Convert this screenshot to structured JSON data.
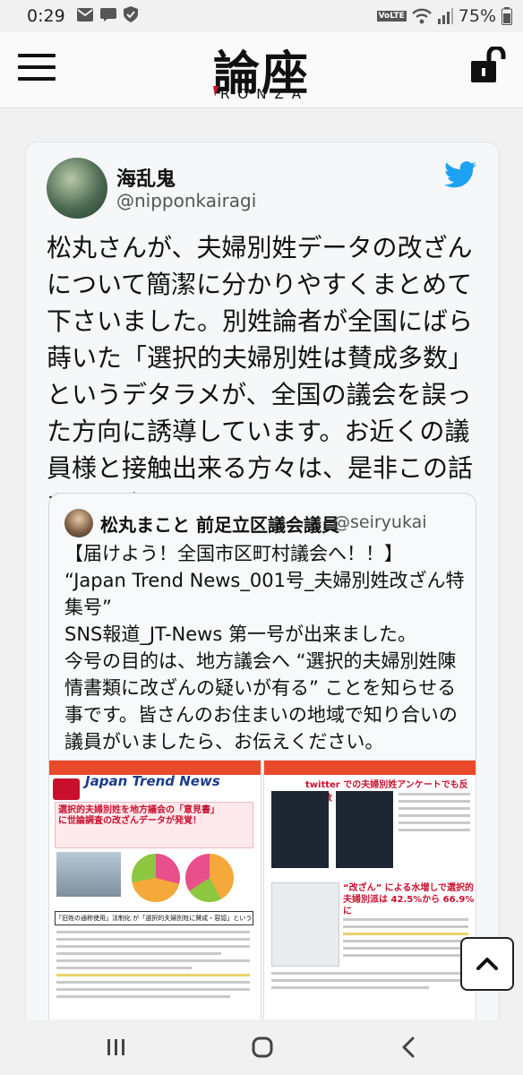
{
  "status_bar": {
    "time": "0:29",
    "battery": "75%",
    "icons": [
      "gmail-icon",
      "message-icon",
      "shield-icon",
      "volte-icon",
      "wifi-icon",
      "signal-icon",
      "battery-icon"
    ]
  },
  "header": {
    "logo_jp": "論座",
    "logo_en": "RONZA",
    "menu_icon": "hamburger-icon",
    "lock_icon": "unlock-icon"
  },
  "tweet": {
    "user_name": "海乱鬼",
    "user_handle": "@nipponkairagi",
    "text": "松丸さんが、夫婦別姓データの改ざんについて簡潔に分かりやすくまとめて下さいました。別姓論者が全国にばら蒔いた「選択的夫婦別姓は賛成多数」というデタラメが、全国の議会を誤った方向に誘導しています。お近くの議員様と接触出来る方々は、是非この話をして広めて下さい。",
    "brand_icon": "twitter-bird-icon"
  },
  "quoted_tweet": {
    "user_name": "松丸まこと 前足立区議会議員",
    "user_handle": "@seiryukai",
    "lines": [
      "【届けよう！全国市区町村議会へ！！】",
      "“Japan Trend News_001号_夫婦別姓改ざん特集号”",
      "SNS報道_JT-News 第一号が出来ました。",
      "今号の目的は、地方議会へ “選択的夫婦別姓陳情書類に改ざんの疑いが有る” ことを知らせる事です。皆さんのお住まいの地域で知り合いの議員がいましたら、お伝えください。"
    ]
  },
  "images": {
    "left": {
      "masthead": "Japan Trend News",
      "headline": "選択的夫婦別姓を地方議会の「意見書」に世論調査の改ざんデータが発覚！",
      "box_title": "「旧姓の通称使用」法制化 が「選択的夫婦別姓に賛成・容認」というウソ"
    },
    "right": {
      "headline": "twitter での夫婦別姓アンケートでも反対多数",
      "pink_caption": "“改ざん” による水増しで選択的夫婦別派は 42.5%から 66.9%に"
    }
  },
  "buttons": {
    "scroll_top": "scroll-top-icon"
  },
  "navbar": {
    "recent": "recent-apps-icon",
    "home": "home-icon",
    "back": "back-icon"
  }
}
